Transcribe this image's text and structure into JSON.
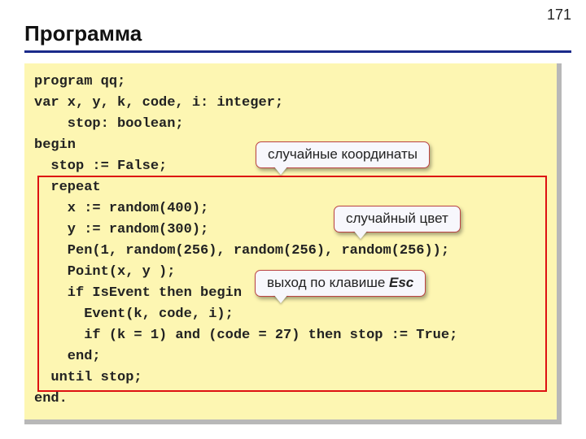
{
  "page_number": "171",
  "title": "Программа",
  "code_lines": [
    "program qq;",
    "var x, y, k, code, i: integer;",
    "    stop: boolean;",
    "begin",
    "  stop := False;",
    "  repeat",
    "    x := random(400);",
    "    y := random(300);",
    "    Pen(1, random(256), random(256), random(256));",
    "    Point(x, y );",
    "    if IsEvent then begin",
    "      Event(k, code, i);",
    "      if (k = 1) and (code = 27) then stop := True;",
    "    end;",
    "  until stop;",
    "end."
  ],
  "callouts": {
    "coords": "случайные координаты",
    "color": "случайный цвет",
    "exit_prefix": "выход по клавише ",
    "exit_key": "Esc"
  }
}
